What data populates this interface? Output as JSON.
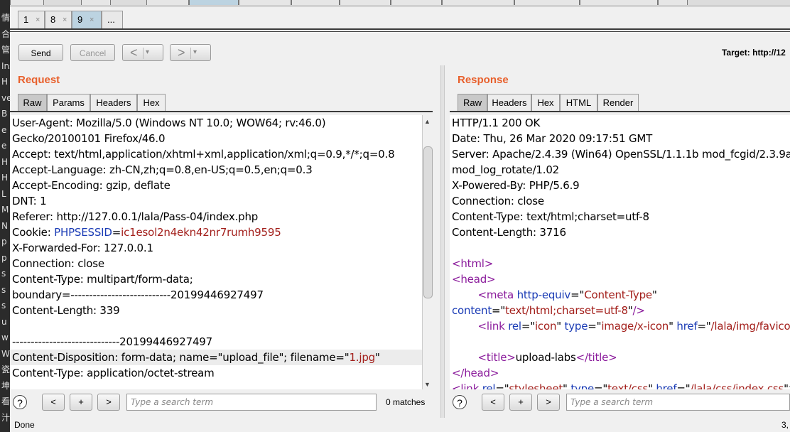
{
  "left_strip_chars": [
    "情",
    "合",
    "管",
    "Ins",
    "H",
    "vel",
    "B",
    "e",
    "e",
    "H",
    "H",
    "L",
    "M",
    "N",
    "p",
    "p",
    "s",
    "s",
    "s",
    "u",
    "w",
    "W",
    "瓷",
    "坤",
    "看",
    "汁"
  ],
  "tabs": [
    {
      "num": "1",
      "close": "×",
      "active": false
    },
    {
      "num": "8",
      "close": "×",
      "active": false
    },
    {
      "num": "9",
      "close": "×",
      "active": true
    },
    {
      "num": "...",
      "close": "",
      "active": false
    }
  ],
  "toolbar": {
    "send_label": "Send",
    "cancel_label": "Cancel",
    "back_arrow": "<",
    "forward_arrow": ">",
    "dropdown_glyph": "▾",
    "target_text": "Target: http://12"
  },
  "request": {
    "title": "Request",
    "tabs": [
      "Raw",
      "Params",
      "Headers",
      "Hex"
    ],
    "active_tab": "Raw",
    "lines": [
      {
        "parts": [
          {
            "t": "User-Agent: Mozilla/5.0 (Windows NT 10.0; WOW64; rv:46.0)"
          }
        ]
      },
      {
        "parts": [
          {
            "t": "Gecko/20100101 Firefox/46.0"
          }
        ]
      },
      {
        "parts": [
          {
            "t": "Accept: text/html,application/xhtml+xml,application/xml;q=0.9,*/*;q=0.8"
          }
        ]
      },
      {
        "parts": [
          {
            "t": "Accept-Language: zh-CN,zh;q=0.8,en-US;q=0.5,en;q=0.3"
          }
        ]
      },
      {
        "parts": [
          {
            "t": "Accept-Encoding: gzip, deflate"
          }
        ]
      },
      {
        "parts": [
          {
            "t": "DNT: 1"
          }
        ]
      },
      {
        "parts": [
          {
            "t": "Referer: http://127.0.0.1/lala/Pass-04/index.php"
          }
        ]
      },
      {
        "parts": [
          {
            "t": "Cookie: "
          },
          {
            "t": "PHPSESSID",
            "c": "blue"
          },
          {
            "t": "="
          },
          {
            "t": "ic1esol2n4ekn42nr7rumh9595",
            "c": "red"
          }
        ]
      },
      {
        "parts": [
          {
            "t": "X-Forwarded-For: 127.0.0.1"
          }
        ]
      },
      {
        "parts": [
          {
            "t": "Connection: close"
          }
        ]
      },
      {
        "parts": [
          {
            "t": "Content-Type: multipart/form-data;"
          }
        ]
      },
      {
        "parts": [
          {
            "t": "boundary=---------------------------20199446927497"
          }
        ]
      },
      {
        "parts": [
          {
            "t": "Content-Length: 339"
          }
        ]
      },
      {
        "parts": [
          {
            "t": ""
          }
        ]
      },
      {
        "parts": [
          {
            "t": "-----------------------------20199446927497"
          }
        ]
      },
      {
        "parts": [
          {
            "t": "Content-Disposition: form-data; name=\"upload_file\"; filename=\""
          },
          {
            "t": "1.jpg",
            "c": "red"
          },
          {
            "t": "\""
          }
        ],
        "highlight": true
      },
      {
        "parts": [
          {
            "t": "Content-Type: application/octet-stream"
          }
        ]
      }
    ],
    "search_placeholder": "Type a search term",
    "matches": "0 matches"
  },
  "response": {
    "title": "Response",
    "tabs": [
      "Raw",
      "Headers",
      "Hex",
      "HTML",
      "Render"
    ],
    "active_tab": "Raw",
    "lines": [
      {
        "parts": [
          {
            "t": "HTTP/1.1 200 OK"
          }
        ]
      },
      {
        "parts": [
          {
            "t": "Date: Thu, 26 Mar 2020 09:17:51 GMT"
          }
        ]
      },
      {
        "parts": [
          {
            "t": "Server: Apache/2.4.39 (Win64) OpenSSL/1.1.1b mod_fcgid/2.3.9a"
          }
        ]
      },
      {
        "parts": [
          {
            "t": "mod_log_rotate/1.02"
          }
        ]
      },
      {
        "parts": [
          {
            "t": "X-Powered-By: PHP/5.6.9"
          }
        ]
      },
      {
        "parts": [
          {
            "t": "Connection: close"
          }
        ]
      },
      {
        "parts": [
          {
            "t": "Content-Type: text/html;charset=utf-8"
          }
        ]
      },
      {
        "parts": [
          {
            "t": "Content-Length: 3716"
          }
        ]
      },
      {
        "parts": [
          {
            "t": ""
          }
        ]
      },
      {
        "parts": [
          {
            "t": "<",
            "c": "purple"
          },
          {
            "t": "html",
            "c": "purple"
          },
          {
            "t": ">",
            "c": "purple"
          }
        ]
      },
      {
        "parts": [
          {
            "t": "<",
            "c": "purple"
          },
          {
            "t": "head",
            "c": "purple"
          },
          {
            "t": ">",
            "c": "purple"
          }
        ]
      },
      {
        "parts": [
          {
            "t": "        "
          },
          {
            "t": "<meta",
            "c": "purple"
          },
          {
            "t": " "
          },
          {
            "t": "http-equiv",
            "c": "blue"
          },
          {
            "t": "=\""
          },
          {
            "t": "Content-Type",
            "c": "red"
          },
          {
            "t": "\""
          }
        ]
      },
      {
        "parts": [
          {
            "t": "content",
            "c": "blue"
          },
          {
            "t": "=\""
          },
          {
            "t": "text/html;charset=utf-8",
            "c": "red"
          },
          {
            "t": "\""
          },
          {
            "t": "/>",
            "c": "purple"
          }
        ]
      },
      {
        "parts": [
          {
            "t": "        "
          },
          {
            "t": "<link",
            "c": "purple"
          },
          {
            "t": " "
          },
          {
            "t": "rel",
            "c": "blue"
          },
          {
            "t": "=\""
          },
          {
            "t": "icon",
            "c": "red"
          },
          {
            "t": "\" "
          },
          {
            "t": "type",
            "c": "blue"
          },
          {
            "t": "=\""
          },
          {
            "t": "image/x-icon",
            "c": "red"
          },
          {
            "t": "\" "
          },
          {
            "t": "href",
            "c": "blue"
          },
          {
            "t": "=\""
          },
          {
            "t": "/lala/img/favicon.png",
            "c": "red"
          }
        ]
      },
      {
        "parts": [
          {
            "t": ""
          }
        ]
      },
      {
        "parts": [
          {
            "t": "        "
          },
          {
            "t": "<title>",
            "c": "purple"
          },
          {
            "t": "upload-labs"
          },
          {
            "t": "</title>",
            "c": "purple"
          }
        ]
      },
      {
        "parts": [
          {
            "t": "</head>",
            "c": "purple"
          }
        ]
      },
      {
        "parts": [
          {
            "t": "<link",
            "c": "purple"
          },
          {
            "t": " "
          },
          {
            "t": "rel",
            "c": "blue"
          },
          {
            "t": "=\""
          },
          {
            "t": "stylesheet",
            "c": "red"
          },
          {
            "t": "\" "
          },
          {
            "t": "type",
            "c": "blue"
          },
          {
            "t": "=\""
          },
          {
            "t": "text/css",
            "c": "red"
          },
          {
            "t": "\" "
          },
          {
            "t": "href",
            "c": "blue"
          },
          {
            "t": "=\""
          },
          {
            "t": "/lala/css/index.css",
            "c": "red"
          },
          {
            "t": "\">"
          }
        ]
      }
    ],
    "search_placeholder": "Type a search term"
  },
  "search_buttons": {
    "help": "?",
    "prev": "<",
    "add": "+",
    "next": ">"
  },
  "status": {
    "left": "Done",
    "right": "3,"
  }
}
